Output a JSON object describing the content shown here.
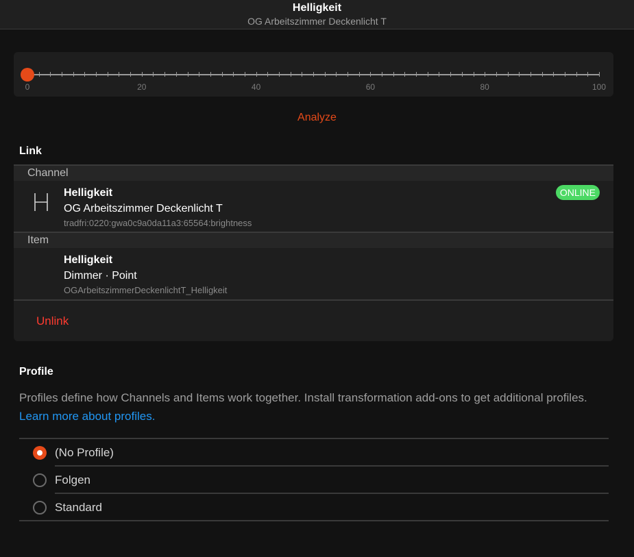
{
  "navbar": {
    "title": "Helligkeit",
    "subtitle": "OG Arbeitszimmer Deckenlicht T"
  },
  "slider": {
    "value": 0,
    "min": 0,
    "max": 100,
    "tick_labels": [
      "0",
      "20",
      "40",
      "60",
      "80",
      "100"
    ]
  },
  "analyze_label": "Analyze",
  "link": {
    "section_title": "Link",
    "channel_header": "Channel",
    "channel": {
      "title": "Helligkeit",
      "subtitle": "OG Arbeitszimmer Deckenlicht T",
      "footer": "tradfri:0220:gwa0c9a0da11a3:65564:brightness",
      "status_badge": "ONLINE",
      "icon": "channel-h-icon"
    },
    "item_header": "Item",
    "item": {
      "title": "Helligkeit",
      "subtitle": "Dimmer · Point",
      "footer": "OGArbeitszimmerDeckenlichtT_Helligkeit"
    },
    "unlink_label": "Unlink"
  },
  "profile": {
    "section_title": "Profile",
    "description": "Profiles define how Channels and Items work together. Install transformation add-ons to get additional profiles.",
    "learn_more": "Learn more about profiles.",
    "options": [
      {
        "label": "(No Profile)",
        "checked": true
      },
      {
        "label": "Folgen",
        "checked": false
      },
      {
        "label": "Standard",
        "checked": false
      }
    ]
  },
  "colors": {
    "accent": "#e64a19",
    "online": "#4cd964",
    "link": "#2196f3",
    "danger": "#ff3b30"
  }
}
